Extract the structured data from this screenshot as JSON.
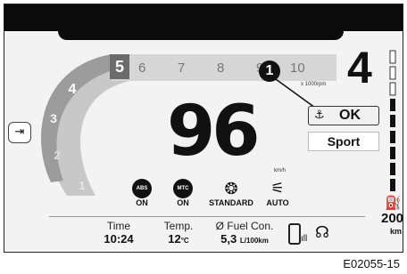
{
  "gear_scale": [
    "1",
    "2",
    "3",
    "4",
    "5"
  ],
  "tach_scale": [
    "6",
    "7",
    "8",
    "9",
    "10"
  ],
  "tach_unit": "x 1000rpm",
  "current_gear": "4",
  "speed": {
    "value": "96",
    "unit": "km/h"
  },
  "callout_number": "1",
  "status": {
    "ok_label": "OK",
    "mode_label": "Sport"
  },
  "controls": [
    {
      "icon": "abs-icon",
      "badge": "ABS",
      "state": "ON"
    },
    {
      "icon": "mtc-icon",
      "badge": "MTC",
      "state": "ON"
    },
    {
      "icon": "riding-mode-icon",
      "badge": "",
      "state": "STANDARD"
    },
    {
      "icon": "auto-suspension-icon",
      "badge": "",
      "state": "AUTO"
    }
  ],
  "bottom_bar": {
    "time_label": "Time",
    "time_value": "10:24",
    "temp_label": "Temp.",
    "temp_value": "12",
    "temp_unit": "°C",
    "fuel_label": "Ø Fuel Con.",
    "fuel_value": "5,3",
    "fuel_unit": "L/100km"
  },
  "range": {
    "value": "200",
    "unit": "km"
  },
  "figure_ref": "E02055-15",
  "colors": {
    "accent_gray": "#c9c9c9",
    "gear_arc": "#9e9e9e",
    "active_gear": "#666666",
    "display_bg": "#f3f3f3"
  }
}
